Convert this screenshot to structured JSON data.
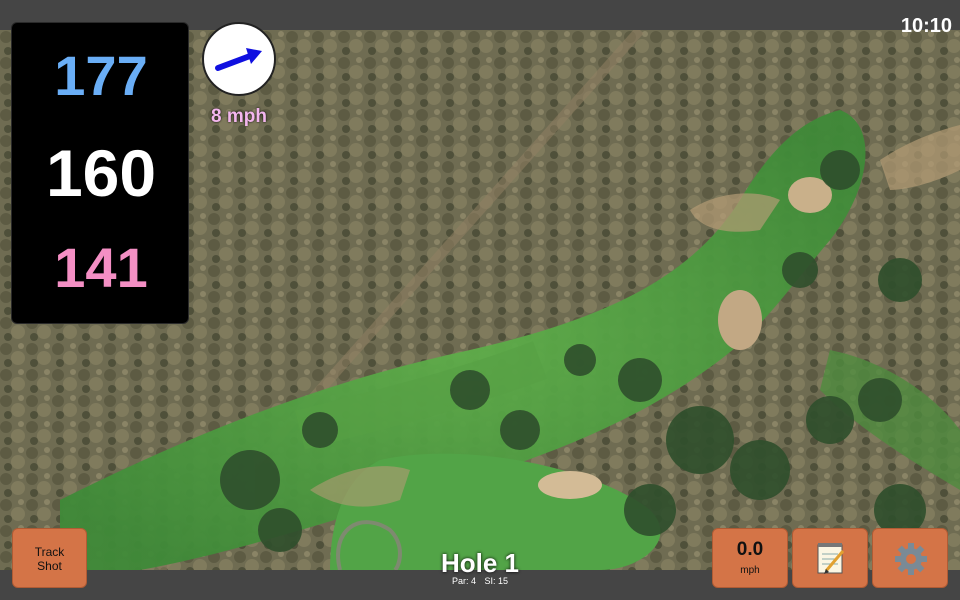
{
  "status_bar": {
    "time": "10:10"
  },
  "yardages": {
    "back": "177",
    "center": "160",
    "front": "141"
  },
  "wind": {
    "speed_label": "8 mph",
    "direction_icon": "arrow-east-northeast-icon",
    "arrow_color": "#1010e0"
  },
  "hole": {
    "title": "Hole 1",
    "par": "Par: 4",
    "si": "SI: 15"
  },
  "buttons": {
    "track_shot": {
      "line1": "Track",
      "line2": "Shot"
    },
    "speed": {
      "value": "0.0",
      "unit": "mph"
    },
    "notes": {
      "icon": "notepad-icon"
    },
    "settings": {
      "icon": "gear-icon"
    }
  },
  "colors": {
    "button": "#d47447",
    "back_yardage": "#6aaef6",
    "front_yardage": "#f48fc4",
    "wind_label": "#f3b6ee"
  }
}
